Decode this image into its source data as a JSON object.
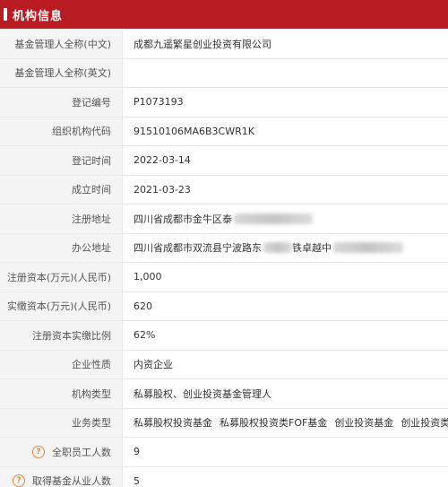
{
  "header": {
    "title": "机构信息"
  },
  "rows": {
    "name_cn": {
      "label": "基金管理人全称(中文)",
      "value": "成都九遥繁星创业投资有限公司"
    },
    "name_en": {
      "label": "基金管理人全称(英文)",
      "value": ""
    },
    "reg_no": {
      "label": "登记编号",
      "value": "P1073193"
    },
    "org_code": {
      "label": "组织机构代码",
      "value": "91510106MA6B3CWR1K"
    },
    "reg_date": {
      "label": "登记时间",
      "value": "2022-03-14"
    },
    "est_date": {
      "label": "成立时间",
      "value": "2021-03-23"
    },
    "reg_addr": {
      "label": "注册地址",
      "value": "四川省成都市金牛区泰"
    },
    "office_addr": {
      "label": "办公地址",
      "value": "四川省成都市双流县宁波路东",
      "value_b": "铁卓越中"
    },
    "reg_capital": {
      "label": "注册资本(万元)(人民币)",
      "value": "1,000"
    },
    "paid_capital": {
      "label": "实缴资本(万元)(人民币)",
      "value": "620"
    },
    "paid_ratio": {
      "label": "注册资本实缴比例",
      "value": "62%"
    },
    "nature": {
      "label": "企业性质",
      "value": "内资企业"
    },
    "org_type": {
      "label": "机构类型",
      "value": "私募股权、创业投资基金管理人"
    },
    "biz_type": {
      "label": "业务类型",
      "tags": [
        "私募股权投资基金",
        "私募股权投资类FOF基金",
        "创业投资基金",
        "创业投资类FOF基金"
      ]
    },
    "employees": {
      "label": "全职员工人数",
      "value": "9",
      "icon": "question-icon"
    },
    "qualified": {
      "label": "取得基金从业人数",
      "value": "5",
      "icon": "question-icon"
    }
  },
  "colors": {
    "header_bg": "#b81c22",
    "label_bg": "#f4f4f4",
    "border": "#e8e8e8",
    "help_icon": "#e08a3c"
  }
}
